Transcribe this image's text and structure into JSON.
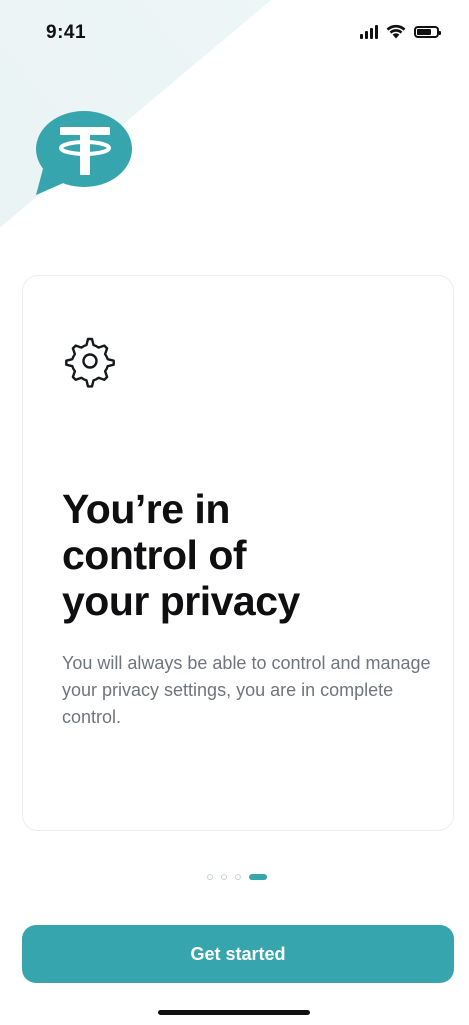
{
  "status_bar": {
    "time": "9:41"
  },
  "logo": {
    "icon": "tether-chat-bubble-icon",
    "color": "#37a5ad"
  },
  "slide": {
    "icon": "gear-icon",
    "headline_lines": [
      "You’re in",
      "control of",
      "your privacy"
    ],
    "body": "You will always be able to control and manage your privacy settings, you are in complete control."
  },
  "pagination": {
    "total": 4,
    "current": 4
  },
  "cta": {
    "label": "Get started",
    "color": "#37a5ad"
  }
}
